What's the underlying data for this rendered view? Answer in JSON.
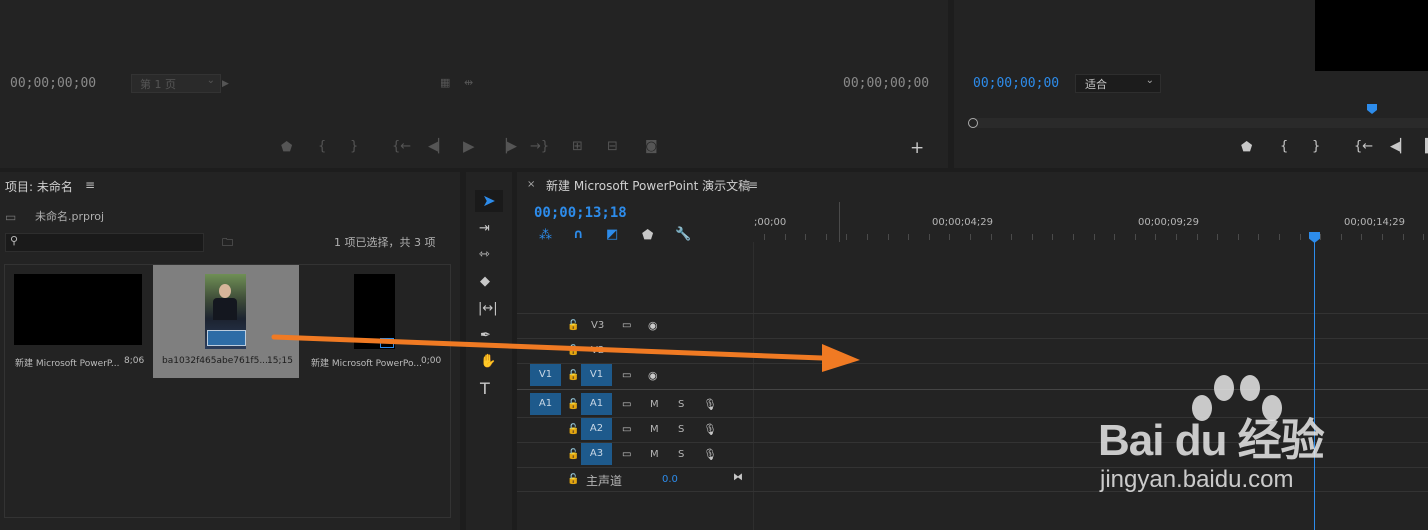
{
  "source_monitor": {
    "timecode_left": "00;00;00;00",
    "page_select": "第 1 页",
    "timecode_right": "00;00;00;00"
  },
  "program_monitor": {
    "timecode": "00;00;00;00",
    "fit_select": "适合"
  },
  "project": {
    "title": "项目: 未命名",
    "file_name": "未命名.prproj",
    "search_placeholder": "",
    "selection_status": "1 项已选择，共 3 项",
    "items": [
      {
        "name": "新建 Microsoft PowerP...",
        "duration": "8;06"
      },
      {
        "name": "ba1032f465abe761f5...",
        "duration": "15;15"
      },
      {
        "name": "新建 Microsoft PowerPo...",
        "duration": "0;00"
      }
    ]
  },
  "timeline": {
    "title": "新建 Microsoft PowerPoint 演示文稿",
    "timecode": "00;00;13;18",
    "ruler_labels": [
      ";00;00",
      "00;00;04;29",
      "00;00;09;29",
      "00;00;14;29"
    ],
    "video_tracks": [
      {
        "name": "V3",
        "source": ""
      },
      {
        "name": "V2",
        "source": ""
      },
      {
        "name": "V1",
        "source": "V1"
      }
    ],
    "audio_tracks": [
      {
        "name": "A1",
        "source": "A1",
        "m": "M",
        "s": "S"
      },
      {
        "name": "A2",
        "source": "",
        "m": "M",
        "s": "S"
      },
      {
        "name": "A3",
        "source": "",
        "m": "M",
        "s": "S"
      }
    ],
    "master": {
      "label": "主声道",
      "value": "0.0"
    }
  },
  "watermark": {
    "brand": "Bai du 经验",
    "url": "jingyan.baidu.com"
  },
  "colors": {
    "accent": "#2d8ceb",
    "arrow": "#f07a23",
    "track_target": "#1e5a8c"
  }
}
